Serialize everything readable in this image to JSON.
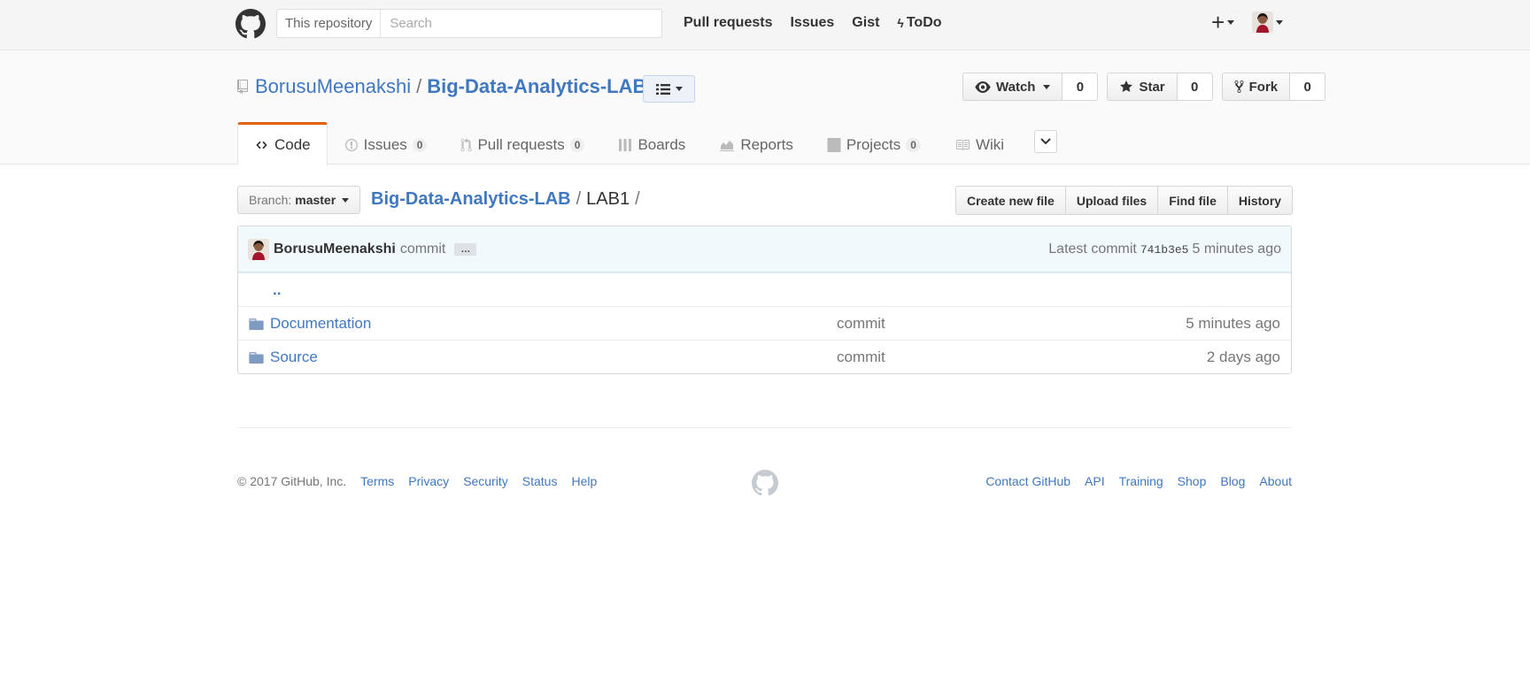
{
  "header": {
    "scope_label": "This repository",
    "search_placeholder": "Search",
    "nav": [
      "Pull requests",
      "Issues",
      "Gist",
      "ToDo"
    ]
  },
  "repo": {
    "owner": "BorusuMeenakshi",
    "separator": "/",
    "name": "Big-Data-Analytics-LAB",
    "watch_label": "Watch",
    "watch_count": "0",
    "star_label": "Star",
    "star_count": "0",
    "fork_label": "Fork",
    "fork_count": "0"
  },
  "tabs": [
    {
      "label": "Code",
      "counter": ""
    },
    {
      "label": "Issues",
      "counter": "0"
    },
    {
      "label": "Pull requests",
      "counter": "0"
    },
    {
      "label": "Boards",
      "counter": ""
    },
    {
      "label": "Reports",
      "counter": ""
    },
    {
      "label": "Projects",
      "counter": "0"
    },
    {
      "label": "Wiki",
      "counter": ""
    }
  ],
  "filenav": {
    "branch_label": "Branch:",
    "branch_value": "master",
    "breadcrumb_root": "Big-Data-Analytics-LAB",
    "breadcrumb_sep": "/",
    "breadcrumb_dir": "LAB1",
    "breadcrumb_trail": "/",
    "actions": [
      "Create new file",
      "Upload files",
      "Find file",
      "History"
    ]
  },
  "commit": {
    "author": "BorusuMeenakshi",
    "message": "commit",
    "ellipsis": "…",
    "latest_label": "Latest commit",
    "sha": "741b3e5",
    "age": "5 minutes ago"
  },
  "files": {
    "up_link": "..",
    "rows": [
      {
        "name": "Documentation",
        "message": "commit",
        "age": "5 minutes ago"
      },
      {
        "name": "Source",
        "message": "commit",
        "age": "2 days ago"
      }
    ]
  },
  "footer": {
    "copyright": "© 2017 GitHub, Inc.",
    "left_links": [
      "Terms",
      "Privacy",
      "Security",
      "Status",
      "Help"
    ],
    "right_links": [
      "Contact GitHub",
      "API",
      "Training",
      "Shop",
      "Blog",
      "About"
    ]
  },
  "colors": {
    "link": "#4078c0",
    "tab_accent": "#e36209",
    "header_bg": "#f5f5f5",
    "commit_bg": "#f2f9fc"
  }
}
